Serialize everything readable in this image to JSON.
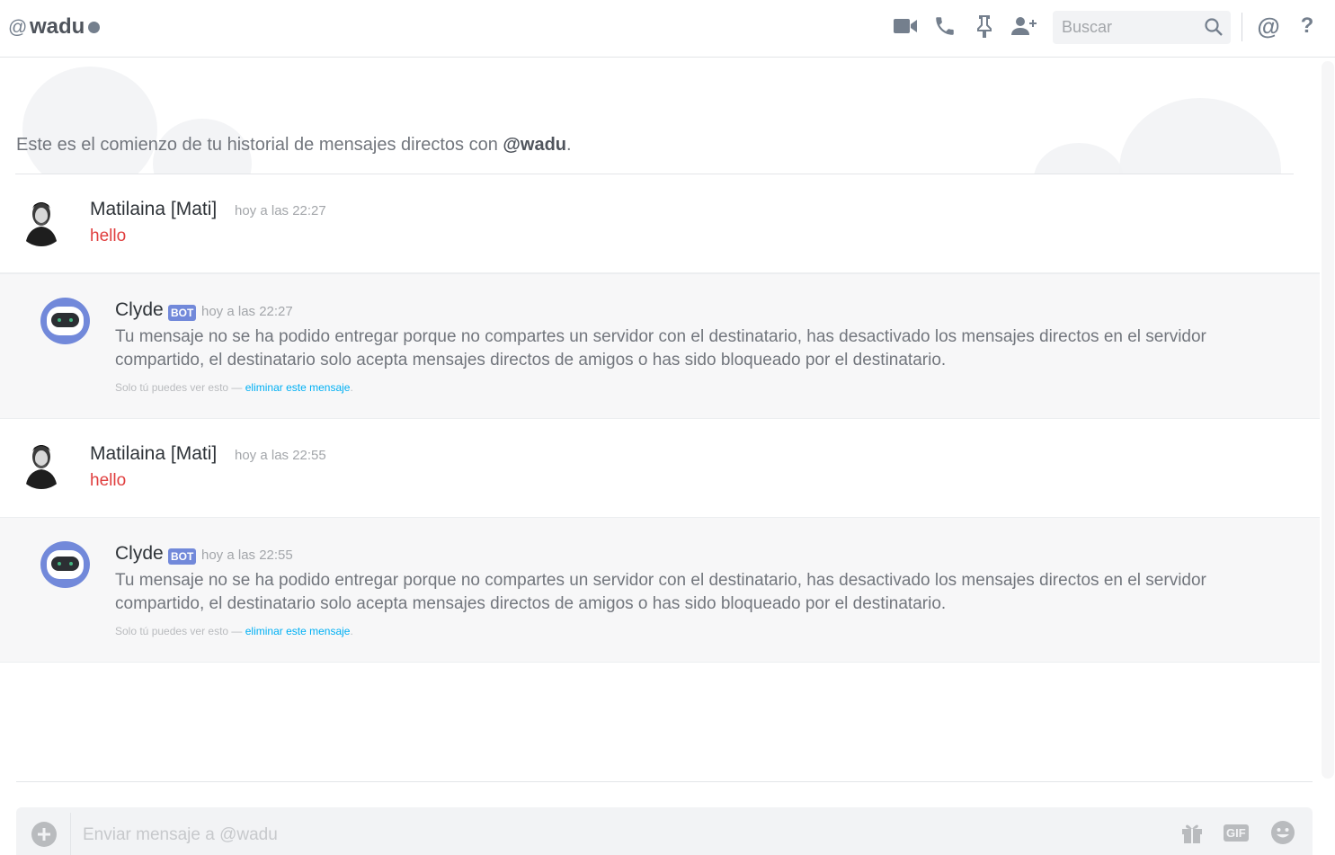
{
  "header": {
    "at_symbol": "@",
    "channel_name": "wadu",
    "search_placeholder": "Buscar",
    "mention_symbol": "@",
    "help_symbol": "?"
  },
  "intro": {
    "text_prefix": "Este es el comienzo de tu historial de mensajes directos con ",
    "user": "@wadu",
    "suffix": "."
  },
  "messages": [
    {
      "author": "Matilaina [Mati]",
      "time": "hoy a las 22:27",
      "text": "hello"
    },
    {
      "author": "Clyde",
      "badge": "BOT",
      "time": "hoy a las 22:27",
      "text": "Tu mensaje no se ha podido entregar porque no compartes un servidor con el destinatario, has desactivado los mensajes directos en el servidor compartido, el destinatario solo acepta mensajes directos de amigos o has sido bloqueado por el destinatario.",
      "note": "Solo tú puedes ver esto — ",
      "note_link": "eliminar este mensaje",
      "note_end": "."
    },
    {
      "author": "Matilaina [Mati]",
      "time": "hoy a las 22:55",
      "text": "hello"
    },
    {
      "author": "Clyde",
      "badge": "BOT",
      "time": "hoy a las 22:55",
      "text": "Tu mensaje no se ha podido entregar porque no compartes un servidor con el destinatario, has desactivado los mensajes directos en el servidor compartido, el destinatario solo acepta mensajes directos de amigos o has sido bloqueado por el destinatario.",
      "note": "Solo tú puedes ver esto — ",
      "note_link": "eliminar este mensaje",
      "note_end": "."
    }
  ],
  "composer": {
    "placeholder": "Enviar mensaje a @wadu",
    "gif_label": "GIF"
  },
  "colors": {
    "accent": "#7289da",
    "link": "#00b0f4",
    "user_text": "#e03e3e"
  }
}
